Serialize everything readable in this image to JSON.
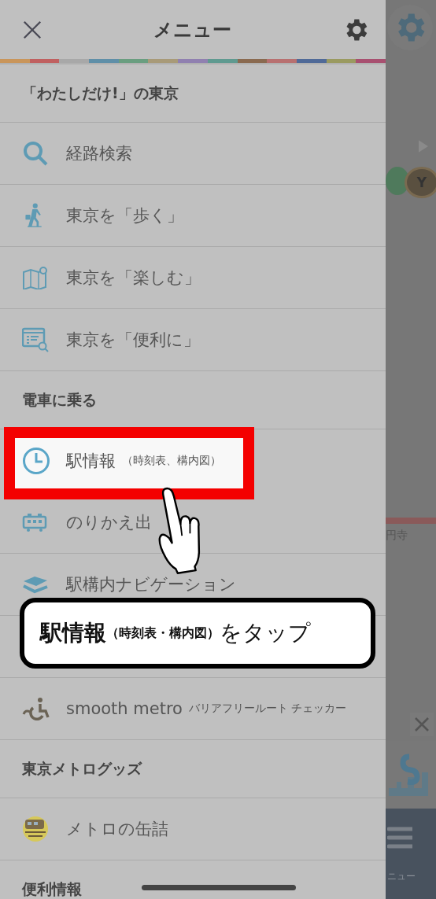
{
  "header": {
    "title": "メニュー"
  },
  "menu": [
    {
      "kind": "section",
      "label": "「わたしだけ!」の東京"
    },
    {
      "kind": "item",
      "label": "経路検索",
      "selected": false
    },
    {
      "kind": "item",
      "label": "東京を「歩く」",
      "selected": false
    },
    {
      "kind": "item",
      "label": "東京を「楽しむ」",
      "selected": false
    },
    {
      "kind": "item",
      "label": "東京を「便利に」",
      "selected": false
    },
    {
      "kind": "section",
      "label": "電車に乗る"
    },
    {
      "kind": "item",
      "label": "駅情報",
      "sub": "（時刻表、構内図）",
      "selected": true
    },
    {
      "kind": "item",
      "label": "のりかえ出",
      "selected": false
    },
    {
      "kind": "item",
      "label": "駅構内ナビゲーション",
      "selected": false
    },
    {
      "kind": "covered"
    },
    {
      "kind": "item",
      "label": "smooth metro",
      "sub": "バリアフリールート チェッカー",
      "selected": false
    },
    {
      "kind": "section",
      "label": "東京メトログッズ"
    },
    {
      "kind": "item",
      "label": "メトロの缶詰",
      "selected": false
    },
    {
      "kind": "section",
      "label": "便利情報"
    }
  ],
  "callout": {
    "title": "駅情報",
    "note": "（時刻表・構内図）",
    "action": "をタップ"
  },
  "background": {
    "badge": "Y",
    "station": "円寺",
    "tab": "ニュー"
  }
}
